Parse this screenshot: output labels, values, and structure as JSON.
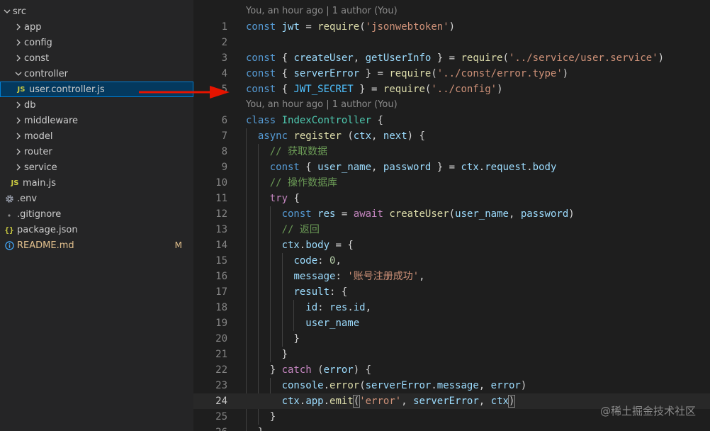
{
  "explorer": {
    "items": [
      {
        "name": "src",
        "type": "folder",
        "open": true,
        "depth": 0
      },
      {
        "name": "app",
        "type": "folder",
        "open": false,
        "depth": 1
      },
      {
        "name": "config",
        "type": "folder",
        "open": false,
        "depth": 1
      },
      {
        "name": "const",
        "type": "folder",
        "open": false,
        "depth": 1
      },
      {
        "name": "controller",
        "type": "folder",
        "open": true,
        "depth": 1
      },
      {
        "name": "user.controller.js",
        "type": "js",
        "depth": 2,
        "selected": true
      },
      {
        "name": "db",
        "type": "folder",
        "open": false,
        "depth": 1
      },
      {
        "name": "middleware",
        "type": "folder",
        "open": false,
        "depth": 1
      },
      {
        "name": "model",
        "type": "folder",
        "open": false,
        "depth": 1
      },
      {
        "name": "router",
        "type": "folder",
        "open": false,
        "depth": 1
      },
      {
        "name": "service",
        "type": "folder",
        "open": false,
        "depth": 1
      },
      {
        "name": "main.js",
        "type": "js",
        "depth": 1
      },
      {
        "name": ".env",
        "type": "gear",
        "depth": 0
      },
      {
        "name": ".gitignore",
        "type": "dot",
        "depth": 0
      },
      {
        "name": "package.json",
        "type": "json",
        "depth": 0
      },
      {
        "name": "README.md",
        "type": "info",
        "depth": 0,
        "badge": "M"
      }
    ]
  },
  "editor": {
    "blame_top": "You, an hour ago | 1 author (You)",
    "blame_class": "You, an hour ago | 1 author (You)",
    "current_line": 24,
    "lines": [
      {
        "n": 1,
        "tokens": [
          [
            "kw",
            "const"
          ],
          [
            "pun",
            " "
          ],
          [
            "var",
            "jwt"
          ],
          [
            "pun",
            " = "
          ],
          [
            "fn",
            "require"
          ],
          [
            "pun",
            "("
          ],
          [
            "str",
            "'jsonwebtoken'"
          ],
          [
            "pun",
            ")"
          ]
        ]
      },
      {
        "n": 2,
        "tokens": []
      },
      {
        "n": 3,
        "tokens": [
          [
            "kw",
            "const"
          ],
          [
            "pun",
            " { "
          ],
          [
            "var",
            "createUser"
          ],
          [
            "pun",
            ", "
          ],
          [
            "var",
            "getUserInfo"
          ],
          [
            "pun",
            " } = "
          ],
          [
            "fn",
            "require"
          ],
          [
            "pun",
            "("
          ],
          [
            "str",
            "'../service/user.service'"
          ],
          [
            "pun",
            ")"
          ]
        ]
      },
      {
        "n": 4,
        "tokens": [
          [
            "kw",
            "const"
          ],
          [
            "pun",
            " { "
          ],
          [
            "var",
            "serverError"
          ],
          [
            "pun",
            " } = "
          ],
          [
            "fn",
            "require"
          ],
          [
            "pun",
            "("
          ],
          [
            "str",
            "'../const/error.type'"
          ],
          [
            "pun",
            ")"
          ]
        ]
      },
      {
        "n": 5,
        "tokens": [
          [
            "kw",
            "const"
          ],
          [
            "pun",
            " { "
          ],
          [
            "const",
            "JWT_SECRET"
          ],
          [
            "pun",
            " } = "
          ],
          [
            "fn",
            "require"
          ],
          [
            "pun",
            "("
          ],
          [
            "str",
            "'../config'"
          ],
          [
            "pun",
            ")"
          ]
        ]
      },
      {
        "n": 6,
        "tokens": [
          [
            "kw",
            "class"
          ],
          [
            "pun",
            " "
          ],
          [
            "cls",
            "IndexController"
          ],
          [
            "pun",
            " {"
          ]
        ]
      },
      {
        "n": 7,
        "tokens": [
          [
            "pun",
            "  "
          ],
          [
            "kw",
            "async"
          ],
          [
            "pun",
            " "
          ],
          [
            "fn",
            "register"
          ],
          [
            "pun",
            " ("
          ],
          [
            "var",
            "ctx"
          ],
          [
            "pun",
            ", "
          ],
          [
            "var",
            "next"
          ],
          [
            "pun",
            ") {"
          ]
        ]
      },
      {
        "n": 8,
        "tokens": [
          [
            "pun",
            "    "
          ],
          [
            "com",
            "// 获取数据"
          ]
        ]
      },
      {
        "n": 9,
        "tokens": [
          [
            "pun",
            "    "
          ],
          [
            "kw",
            "const"
          ],
          [
            "pun",
            " { "
          ],
          [
            "var",
            "user_name"
          ],
          [
            "pun",
            ", "
          ],
          [
            "var",
            "password"
          ],
          [
            "pun",
            " } = "
          ],
          [
            "var",
            "ctx"
          ],
          [
            "pun",
            "."
          ],
          [
            "var",
            "request"
          ],
          [
            "pun",
            "."
          ],
          [
            "var",
            "body"
          ]
        ]
      },
      {
        "n": 10,
        "tokens": [
          [
            "pun",
            "    "
          ],
          [
            "com",
            "// 操作数据库"
          ]
        ]
      },
      {
        "n": 11,
        "tokens": [
          [
            "pun",
            "    "
          ],
          [
            "kwc",
            "try"
          ],
          [
            "pun",
            " {"
          ]
        ]
      },
      {
        "n": 12,
        "tokens": [
          [
            "pun",
            "      "
          ],
          [
            "kw",
            "const"
          ],
          [
            "pun",
            " "
          ],
          [
            "var",
            "res"
          ],
          [
            "pun",
            " = "
          ],
          [
            "kwc",
            "await"
          ],
          [
            "pun",
            " "
          ],
          [
            "fn",
            "createUser"
          ],
          [
            "pun",
            "("
          ],
          [
            "var",
            "user_name"
          ],
          [
            "pun",
            ", "
          ],
          [
            "var",
            "password"
          ],
          [
            "pun",
            ")"
          ]
        ]
      },
      {
        "n": 13,
        "tokens": [
          [
            "pun",
            "      "
          ],
          [
            "com",
            "// 返回"
          ]
        ]
      },
      {
        "n": 14,
        "tokens": [
          [
            "pun",
            "      "
          ],
          [
            "var",
            "ctx"
          ],
          [
            "pun",
            "."
          ],
          [
            "var",
            "body"
          ],
          [
            "pun",
            " = {"
          ]
        ]
      },
      {
        "n": 15,
        "tokens": [
          [
            "pun",
            "        "
          ],
          [
            "var",
            "code"
          ],
          [
            "pun",
            ": "
          ],
          [
            "num",
            "0"
          ],
          [
            "pun",
            ","
          ]
        ]
      },
      {
        "n": 16,
        "tokens": [
          [
            "pun",
            "        "
          ],
          [
            "var",
            "message"
          ],
          [
            "pun",
            ": "
          ],
          [
            "str",
            "'账号注册成功'"
          ],
          [
            "pun",
            ","
          ]
        ]
      },
      {
        "n": 17,
        "tokens": [
          [
            "pun",
            "        "
          ],
          [
            "var",
            "result"
          ],
          [
            "pun",
            ": {"
          ]
        ]
      },
      {
        "n": 18,
        "tokens": [
          [
            "pun",
            "          "
          ],
          [
            "var",
            "id"
          ],
          [
            "pun",
            ": "
          ],
          [
            "var",
            "res"
          ],
          [
            "pun",
            "."
          ],
          [
            "var",
            "id"
          ],
          [
            "pun",
            ","
          ]
        ]
      },
      {
        "n": 19,
        "tokens": [
          [
            "pun",
            "          "
          ],
          [
            "var",
            "user_name"
          ]
        ]
      },
      {
        "n": 20,
        "tokens": [
          [
            "pun",
            "        }"
          ]
        ]
      },
      {
        "n": 21,
        "tokens": [
          [
            "pun",
            "      }"
          ]
        ]
      },
      {
        "n": 22,
        "tokens": [
          [
            "pun",
            "    } "
          ],
          [
            "kwc",
            "catch"
          ],
          [
            "pun",
            " ("
          ],
          [
            "var",
            "error"
          ],
          [
            "pun",
            ") {"
          ]
        ]
      },
      {
        "n": 23,
        "tokens": [
          [
            "pun",
            "      "
          ],
          [
            "var",
            "console"
          ],
          [
            "pun",
            "."
          ],
          [
            "fn",
            "error"
          ],
          [
            "pun",
            "("
          ],
          [
            "var",
            "serverError"
          ],
          [
            "pun",
            "."
          ],
          [
            "var",
            "message"
          ],
          [
            "pun",
            ", "
          ],
          [
            "var",
            "error"
          ],
          [
            "pun",
            ")"
          ]
        ]
      },
      {
        "n": 24,
        "tokens": [
          [
            "pun",
            "      "
          ],
          [
            "var",
            "ctx"
          ],
          [
            "pun",
            "."
          ],
          [
            "var",
            "app"
          ],
          [
            "pun",
            "."
          ],
          [
            "fn",
            "emit"
          ],
          [
            "pun",
            "("
          ],
          [
            "str",
            "'error'"
          ],
          [
            "pun",
            ", "
          ],
          [
            "var",
            "serverError"
          ],
          [
            "pun",
            ", "
          ],
          [
            "var",
            "ctx"
          ],
          [
            "pun",
            ")"
          ]
        ]
      },
      {
        "n": 25,
        "tokens": [
          [
            "pun",
            "    }"
          ]
        ]
      },
      {
        "n": 26,
        "tokens": [
          [
            "pun",
            "  }"
          ]
        ]
      }
    ]
  },
  "colors": {
    "accent": "#007fd4",
    "selection": "#04395e",
    "arrow": "#e51400"
  },
  "watermark": "@稀土掘金技术社区"
}
